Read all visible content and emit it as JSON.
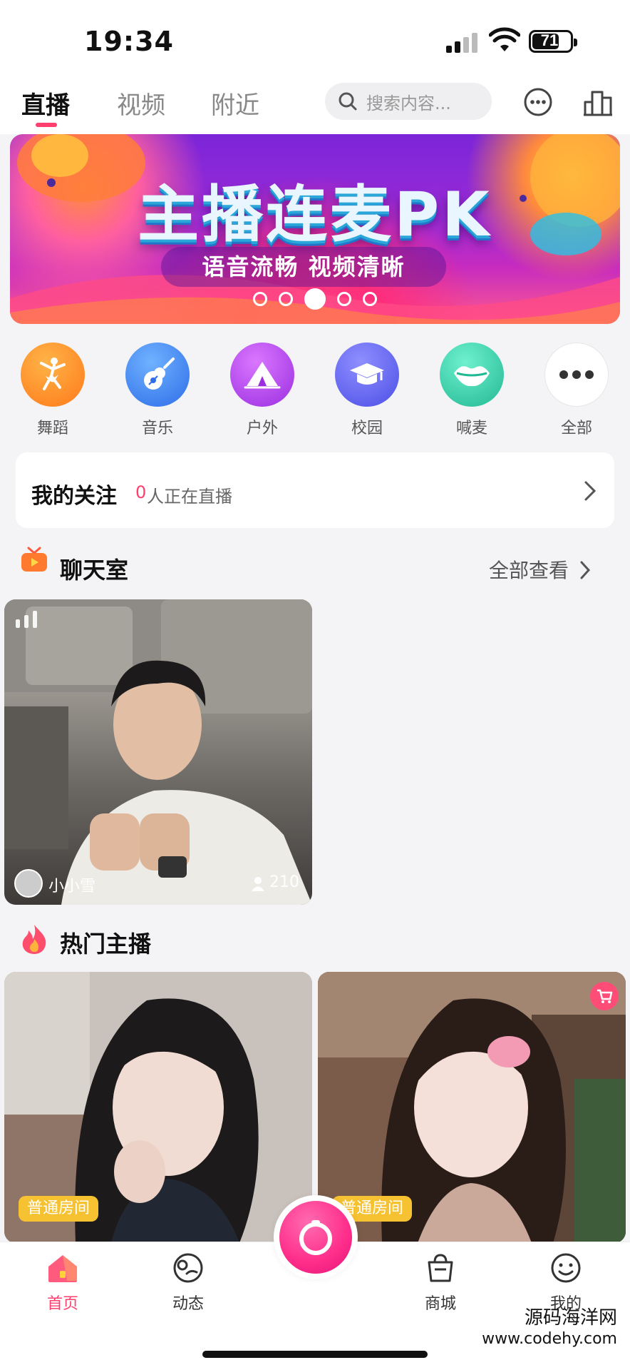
{
  "status_bar": {
    "time": "19:34",
    "battery": "71",
    "battery_level": 0.71
  },
  "top_nav": {
    "tabs": [
      {
        "label": "直播",
        "active": true
      },
      {
        "label": "视频",
        "active": false
      },
      {
        "label": "附近",
        "active": false
      }
    ],
    "search": {
      "placeholder": "搜索内容..."
    },
    "icons": [
      "search-icon",
      "chat-bubble-icon",
      "ranking-icon"
    ]
  },
  "banner": {
    "title": "主播连麦PK",
    "subtitle": "语音流畅  视频清晰",
    "slide_count": 5,
    "active_slide": 3
  },
  "categories": [
    {
      "label": "舞蹈",
      "icon": "dancer-icon",
      "color": "#ff8a1f"
    },
    {
      "label": "音乐",
      "icon": "guitar-icon",
      "color": "#3a7df0"
    },
    {
      "label": "户外",
      "icon": "tent-icon",
      "color": "#b235e6"
    },
    {
      "label": "校园",
      "icon": "graduation-cap-icon",
      "color": "#5a5ff0"
    },
    {
      "label": "喊麦",
      "icon": "lips-icon",
      "color": "#2fc9a6"
    },
    {
      "label": "全部",
      "icon": "more-dots-icon",
      "color": "#ffffff"
    }
  ],
  "follow": {
    "title": "我的关注",
    "count": "0",
    "suffix": "人正在直播"
  },
  "chatroom": {
    "title": "聊天室",
    "see_all": "全部查看",
    "rooms": [
      {
        "host": "小小雪",
        "viewers": "210"
      }
    ]
  },
  "hot_hosts": {
    "title": "热门主播",
    "items": [
      {
        "badge": "普通房间",
        "shop": false
      },
      {
        "badge": "普通房间",
        "shop": true
      }
    ]
  },
  "tab_bar": {
    "items": [
      {
        "label": "首页",
        "icon": "home-icon",
        "active": true
      },
      {
        "label": "动态",
        "icon": "moments-icon",
        "active": false
      },
      {
        "label": "商城",
        "icon": "shop-bag-icon",
        "active": false
      },
      {
        "label": "我的",
        "icon": "smiley-icon",
        "active": false
      }
    ],
    "center": {
      "icon": "camera-live-icon"
    }
  },
  "watermark": {
    "line1": "源码海洋网",
    "line2": "www.codehy.com"
  },
  "colors": {
    "accent": "#ff3f6d",
    "badge": "#f6c232",
    "background": "#f4f4f6"
  }
}
